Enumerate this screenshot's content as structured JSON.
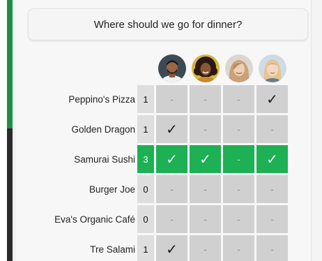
{
  "question": "Where should we go for dinner?",
  "colors": {
    "accent_green": "#1db055",
    "cell_gray": "#d0d0d0",
    "count_gray": "#dedede"
  },
  "participants": [
    {
      "icon": "avatar-man-icon"
    },
    {
      "icon": "avatar-woman-curly-icon"
    },
    {
      "icon": "avatar-woman-smiling-icon"
    },
    {
      "icon": "avatar-woman-blonde-icon"
    }
  ],
  "options": [
    {
      "name": "Peppino's Pizza",
      "count": "1",
      "votes": [
        "-",
        "-",
        "-",
        "✓"
      ],
      "winner": false
    },
    {
      "name": "Golden Dragon",
      "count": "1",
      "votes": [
        "✓",
        "-",
        "-",
        "-"
      ],
      "winner": false
    },
    {
      "name": "Samurai Sushi",
      "count": "3",
      "votes": [
        "✓",
        "✓",
        "-",
        "✓"
      ],
      "winner": true
    },
    {
      "name": "Burger Joe",
      "count": "0",
      "votes": [
        "-",
        "-",
        "-",
        "-"
      ],
      "winner": false
    },
    {
      "name": "Eva's Organic Café",
      "count": "0",
      "votes": [
        "-",
        "-",
        "-",
        "-"
      ],
      "winner": false
    },
    {
      "name": "Tre Salami",
      "count": "1",
      "votes": [
        "✓",
        "-",
        "-",
        "-"
      ],
      "winner": false
    }
  ]
}
